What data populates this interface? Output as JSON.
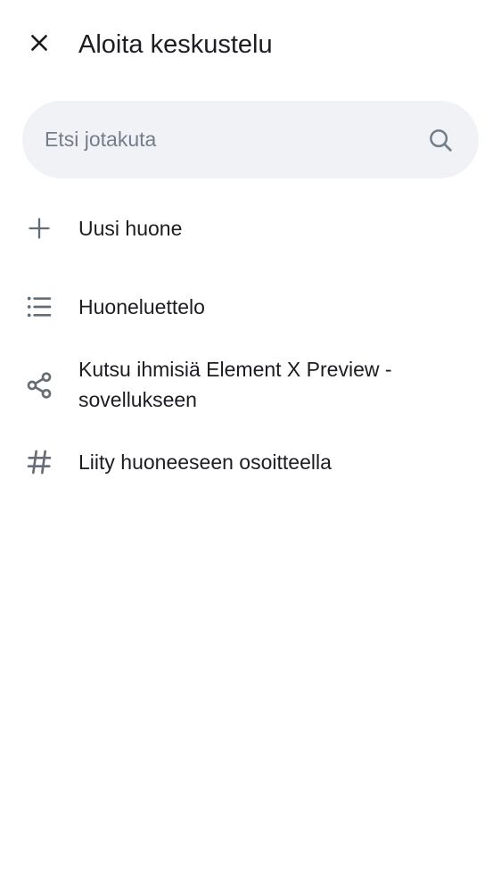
{
  "header": {
    "close_icon": "close-icon",
    "title": "Aloita keskustelu"
  },
  "search": {
    "placeholder": "Etsi jotakuta",
    "value": "",
    "icon": "search-icon"
  },
  "menu": {
    "items": [
      {
        "icon": "plus-icon",
        "label": "Uusi huone"
      },
      {
        "icon": "list-icon",
        "label": "Huoneluettelo"
      },
      {
        "icon": "share-icon",
        "label": "Kutsu ihmisiä Element X Preview -sovellukseen"
      },
      {
        "icon": "hash-icon",
        "label": "Liity huoneeseen osoitteella"
      }
    ]
  },
  "colors": {
    "background": "#ffffff",
    "text_primary": "#1b1d22",
    "text_secondary": "#737d8c",
    "icon": "#656d77",
    "search_background": "#f0f2f5"
  }
}
